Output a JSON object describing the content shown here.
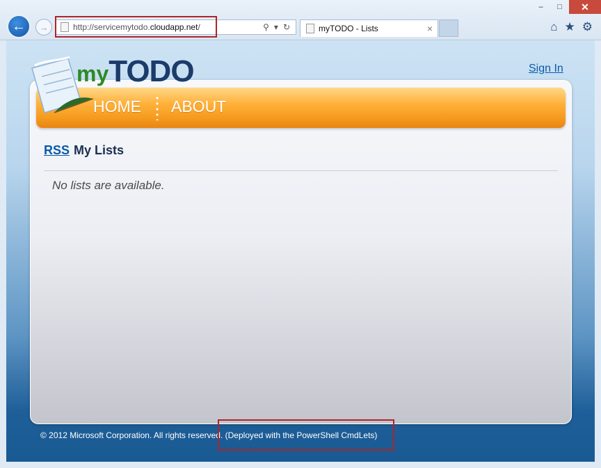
{
  "browser": {
    "url_prefix": "http://servicemytodo.",
    "url_domain": "cloudapp.net",
    "url_suffix": "/",
    "tab_title": "myTODO - Lists",
    "tab_close": "×",
    "window_controls": [
      "–",
      "□",
      "✕"
    ],
    "back_glyph": "←",
    "forward_glyph": "→",
    "address_tools": [
      "⚲",
      "▾",
      "↻"
    ],
    "right_icons": [
      "⌂",
      "★",
      "⚙"
    ]
  },
  "header": {
    "brand_prefix": "my",
    "brand_name": "TODO",
    "sign_in": "Sign In"
  },
  "nav": {
    "items": [
      "HOME",
      "ABOUT"
    ]
  },
  "main": {
    "rss_link": "RSS",
    "title": "My Lists",
    "empty_message": "No lists are available."
  },
  "footer": {
    "copyright": "© 2012 Microsoft Corporation. All rights reserved.",
    "deployment_note": "(Deployed with the PowerShell CmdLets)"
  },
  "colors": {
    "accent_orange": "#f59b1e",
    "link_blue": "#0a5aa8",
    "highlight_red": "#b0232a"
  }
}
